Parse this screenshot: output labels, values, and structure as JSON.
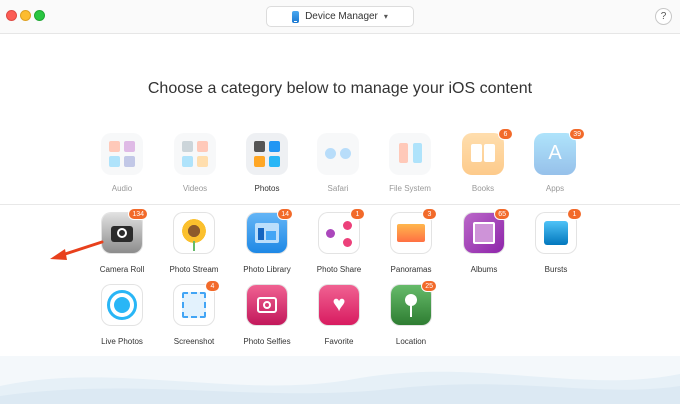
{
  "window": {
    "device_label": "Device Manager",
    "help_label": "?"
  },
  "headline": "Choose a category below to manage your iOS content",
  "categories": [
    {
      "label": "Audio",
      "badge": ""
    },
    {
      "label": "Videos",
      "badge": ""
    },
    {
      "label": "Photos",
      "badge": ""
    },
    {
      "label": "Safari",
      "badge": ""
    },
    {
      "label": "File System",
      "badge": ""
    },
    {
      "label": "Books",
      "badge": "6"
    },
    {
      "label": "Apps",
      "badge": "39"
    }
  ],
  "photo_tiles": [
    {
      "label": "Camera Roll",
      "badge": "134"
    },
    {
      "label": "Photo Stream",
      "badge": ""
    },
    {
      "label": "Photo Library",
      "badge": "14"
    },
    {
      "label": "Photo Share",
      "badge": "1"
    },
    {
      "label": "Panoramas",
      "badge": "3"
    },
    {
      "label": "Albums",
      "badge": "65"
    },
    {
      "label": "Bursts",
      "badge": "1"
    },
    {
      "label": "Live Photos",
      "badge": ""
    },
    {
      "label": "Screenshot",
      "badge": "4"
    },
    {
      "label": "Photo Selfies",
      "badge": ""
    },
    {
      "label": "Favorite",
      "badge": ""
    },
    {
      "label": "Location",
      "badge": "25"
    }
  ],
  "colors": {
    "accent_badge": "#f26a2a",
    "pointer_arrow": "#e8401c"
  }
}
